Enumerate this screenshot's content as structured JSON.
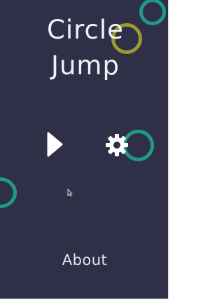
{
  "game": {
    "title_line_1": "Circle",
    "title_line_2": "Jump"
  },
  "menu": {
    "play_icon": "play-icon",
    "settings_icon": "gear-icon",
    "about_label": "About"
  },
  "colors": {
    "background": "#2f2f48",
    "ring_teal": "#1e9a86",
    "ring_olive": "#9a9b2e",
    "text": "#f2f2f6"
  }
}
